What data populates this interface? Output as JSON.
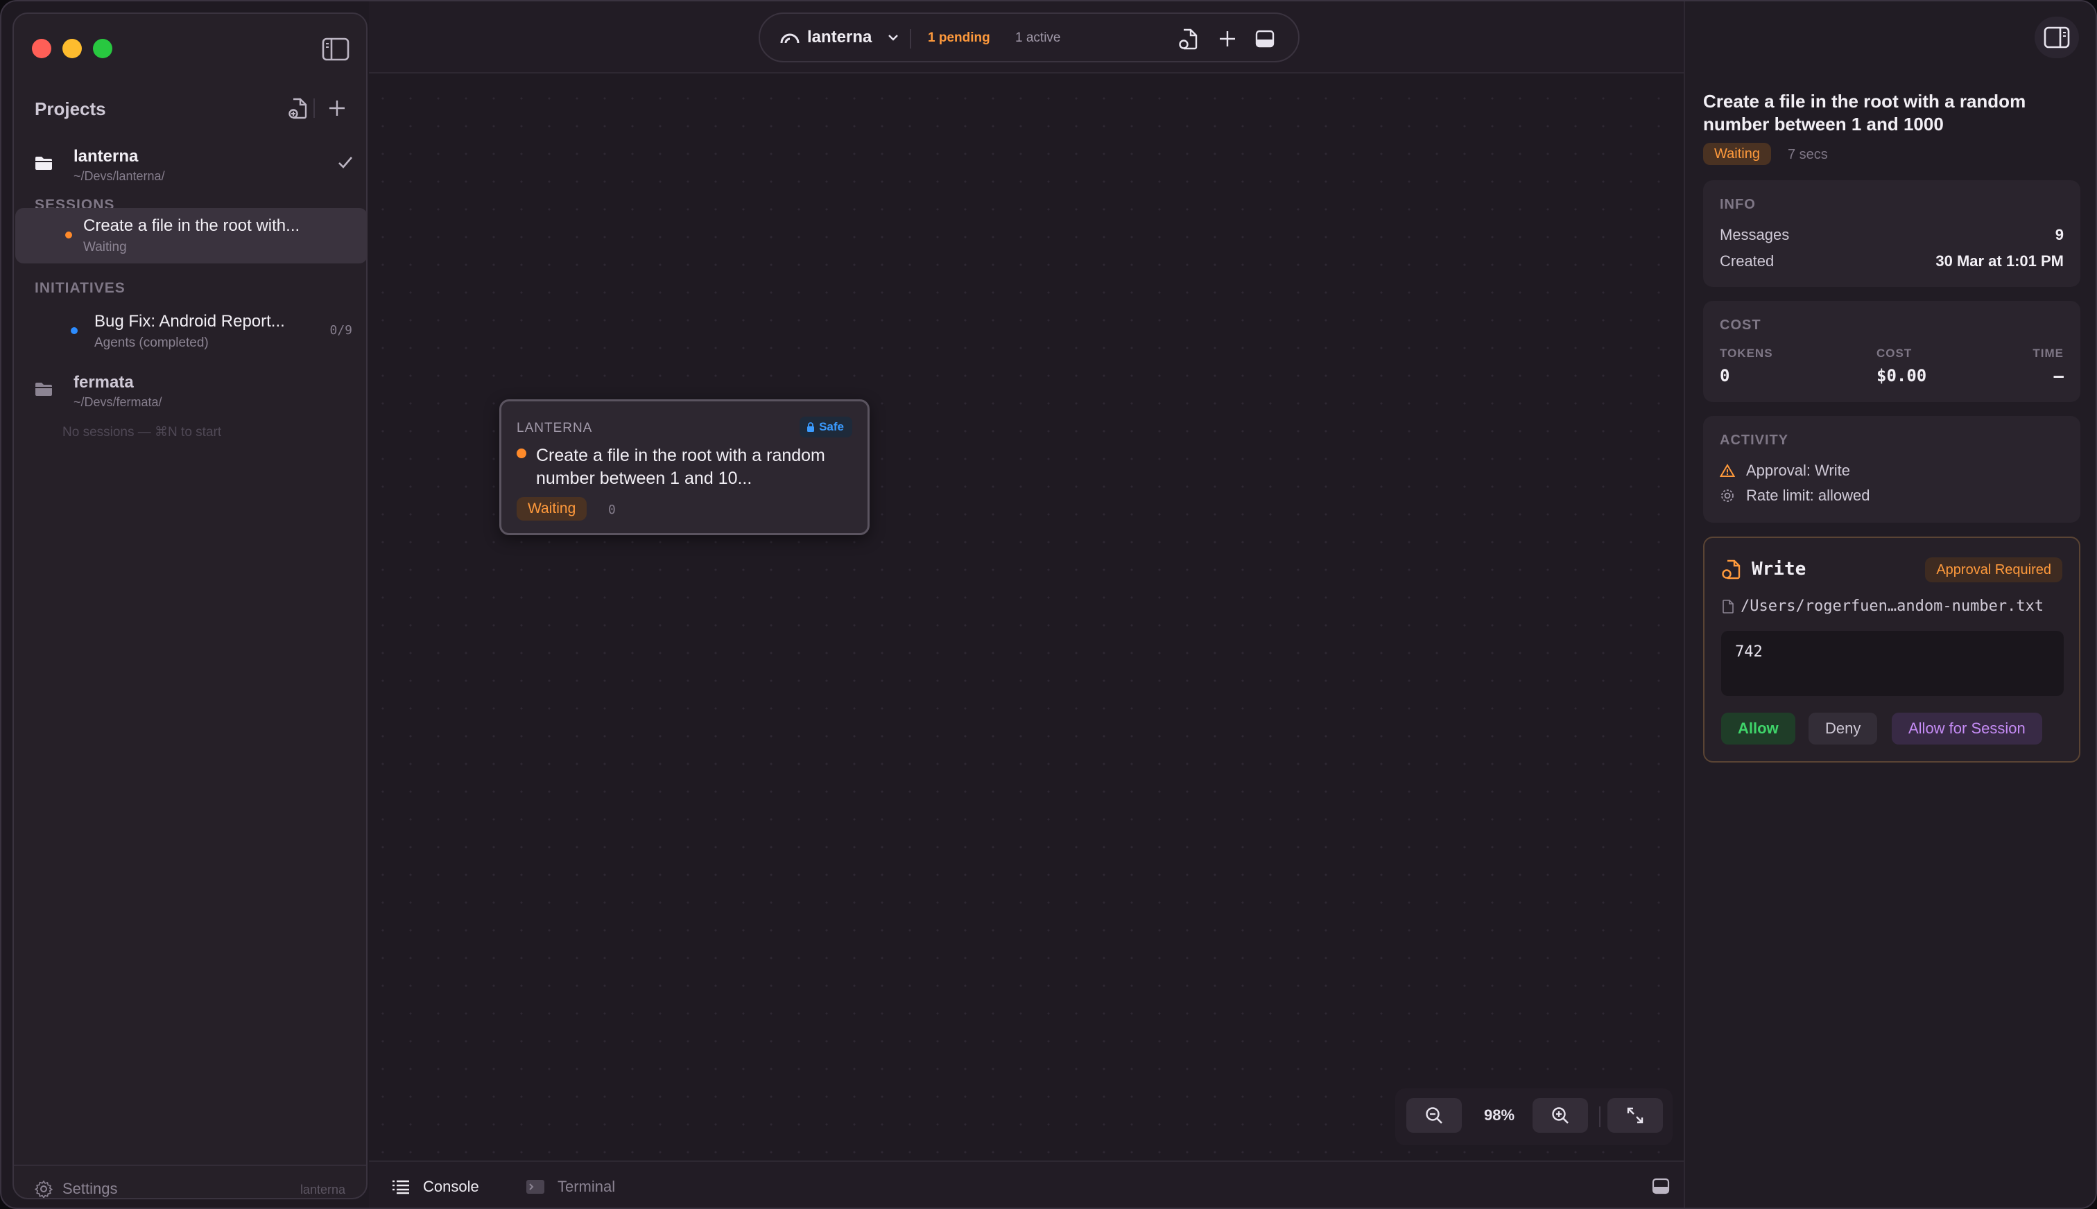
{
  "sidebar": {
    "projects_title": "Projects",
    "projects": [
      {
        "name": "lanterna",
        "path": "~/Devs/lanterna/"
      },
      {
        "name": "fermata",
        "path": "~/Devs/fermata/"
      }
    ],
    "sessions_label": "SESSIONS",
    "session": {
      "title": "Create a file in the root with...",
      "status": "Waiting"
    },
    "initiatives_label": "INITIATIVES",
    "initiative": {
      "title": "Bug Fix: Android Report...",
      "status": "Agents (completed)",
      "count": "0/9"
    },
    "no_sessions": "No sessions — ⌘N to start",
    "settings_label": "Settings",
    "footer_project": "lanterna"
  },
  "topbar": {
    "project": "lanterna",
    "pending": "1 pending",
    "active": "1 active"
  },
  "node": {
    "project": "LANTERNA",
    "safe": "Safe",
    "title": "Create a file in the root with a random number between 1 and 10...",
    "status": "Waiting",
    "count": "0"
  },
  "zoom": {
    "level": "98%"
  },
  "bottom": {
    "console": "Console",
    "terminal": "Terminal"
  },
  "panel": {
    "title": "Create a file in the root with a random number between 1 and 1000",
    "status": "Waiting",
    "elapsed": "7 secs",
    "info": {
      "label": "INFO",
      "messages_label": "Messages",
      "messages": "9",
      "created_label": "Created",
      "created": "30 Mar at 1:01 PM"
    },
    "cost": {
      "label": "COST",
      "tokens_label": "TOKENS",
      "tokens": "0",
      "cost_label": "COST",
      "cost": "$0.00",
      "time_label": "TIME",
      "time": "—"
    },
    "activity": {
      "label": "ACTIVITY",
      "items": [
        "Approval: Write",
        "Rate limit: allowed"
      ]
    },
    "write": {
      "title": "Write",
      "badge": "Approval Required",
      "file": "/Users/rogerfuen…andom-number.txt",
      "content": "742",
      "allow": "Allow",
      "deny": "Deny",
      "allow_session": "Allow for Session"
    }
  },
  "colors": {
    "accent_orange": "#ff9a3c",
    "safe_blue": "#3b9bff",
    "allow_green": "#3fd56a",
    "session_purple": "#c58cf5"
  }
}
